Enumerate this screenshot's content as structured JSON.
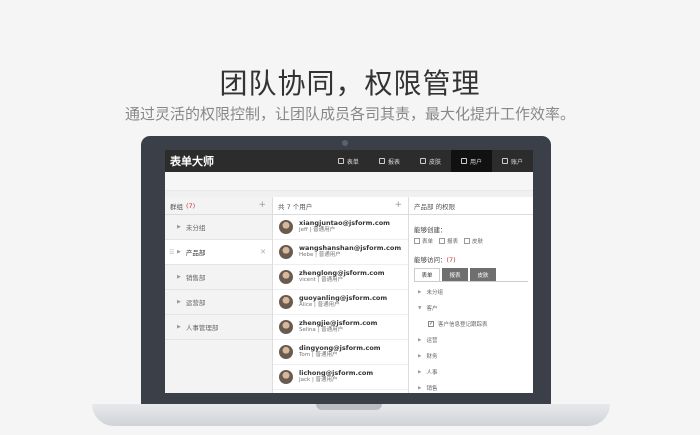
{
  "hero": {
    "title": "团队协同，权限管理",
    "subtitle": "通过灵活的权限控制，让团队成员各司其责，最大化提升工作效率。"
  },
  "app": {
    "logo": "表单大师",
    "nav": [
      {
        "label": "表单",
        "icon": "form-icon",
        "active": false
      },
      {
        "label": "报表",
        "icon": "chart-icon",
        "active": false
      },
      {
        "label": "皮肤",
        "icon": "palette-icon",
        "active": false
      },
      {
        "label": "用户",
        "icon": "users-icon",
        "active": true
      },
      {
        "label": "账户",
        "icon": "account-icon",
        "active": false
      }
    ]
  },
  "groups": {
    "header_label": "群组",
    "header_count": "(7)",
    "items": [
      {
        "label": "未分组",
        "active": false
      },
      {
        "label": "产品部",
        "active": true
      },
      {
        "label": "销售部",
        "active": false
      },
      {
        "label": "运营部",
        "active": false
      },
      {
        "label": "人事管理部",
        "active": false
      }
    ]
  },
  "users": {
    "header": "共 7 个用户",
    "items": [
      {
        "email": "xiangjuntao@jsform.com",
        "role": "Jeff | 普通用户"
      },
      {
        "email": "wangshanshan@jsform.com",
        "role": "Hebe | 普通用户"
      },
      {
        "email": "zhenglong@jsform.com",
        "role": "vicent | 普通用户"
      },
      {
        "email": "guoyanling@jsform.com",
        "role": "Alice | 普通用户"
      },
      {
        "email": "zhengjie@jsform.com",
        "role": "Selina | 普通用户"
      },
      {
        "email": "dingyong@jsform.com",
        "role": "Tom | 普通用户"
      },
      {
        "email": "lichong@jsform.com",
        "role": "Jack | 普通用户"
      }
    ]
  },
  "permissions": {
    "title": "产品部 的权限",
    "create_label": "能够创建：",
    "create_options": [
      "表单",
      "报表",
      "皮肤"
    ],
    "access_label": "能够访问：",
    "access_count": "(7)",
    "tabs": [
      {
        "label": "表单",
        "active": true
      },
      {
        "label": "报表",
        "active": false
      },
      {
        "label": "皮肤",
        "active": false
      }
    ],
    "tree": [
      {
        "label": "未分组",
        "type": "collapsed"
      },
      {
        "label": "客户",
        "type": "expanded"
      },
      {
        "label": "客户信息登记跟踪表",
        "type": "child"
      },
      {
        "label": "运营",
        "type": "collapsed"
      },
      {
        "label": "财务",
        "type": "collapsed"
      },
      {
        "label": "人事",
        "type": "collapsed"
      },
      {
        "label": "销售",
        "type": "collapsed"
      }
    ]
  },
  "colors": {
    "accent_red": "#cc3333",
    "topbar": "#2c2c2c",
    "laptop_frame": "#3b3f47"
  }
}
